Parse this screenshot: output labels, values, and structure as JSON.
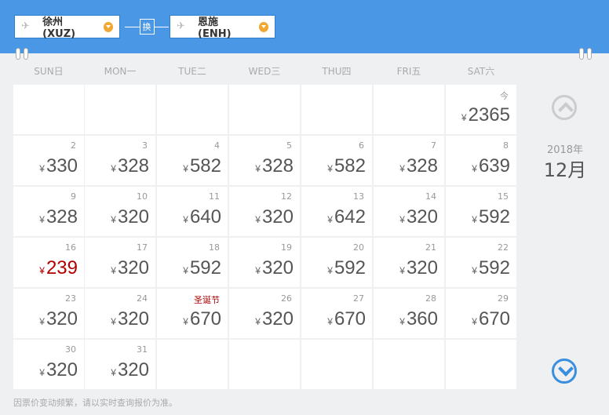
{
  "route": {
    "from": "徐州(XUZ)",
    "to": "恩施(ENH)",
    "swap_label": "换"
  },
  "weekdays": [
    "SUN日",
    "MON一",
    "TUE二",
    "WED三",
    "THU四",
    "FRI五",
    "SAT六"
  ],
  "calendar": {
    "year": "2018年",
    "month": "12月",
    "currency": "¥"
  },
  "weeks": [
    [
      null,
      null,
      null,
      null,
      null,
      null,
      {
        "day": "今",
        "price": "2365"
      }
    ],
    [
      {
        "day": "2",
        "price": "330"
      },
      {
        "day": "3",
        "price": "328"
      },
      {
        "day": "4",
        "price": "582"
      },
      {
        "day": "5",
        "price": "328"
      },
      {
        "day": "6",
        "price": "582"
      },
      {
        "day": "7",
        "price": "328"
      },
      {
        "day": "8",
        "price": "639"
      }
    ],
    [
      {
        "day": "9",
        "price": "328"
      },
      {
        "day": "10",
        "price": "320"
      },
      {
        "day": "11",
        "price": "640"
      },
      {
        "day": "12",
        "price": "320"
      },
      {
        "day": "13",
        "price": "642"
      },
      {
        "day": "14",
        "price": "320"
      },
      {
        "day": "15",
        "price": "592"
      }
    ],
    [
      {
        "day": "16",
        "price": "239",
        "lowest": true
      },
      {
        "day": "17",
        "price": "320"
      },
      {
        "day": "18",
        "price": "592"
      },
      {
        "day": "19",
        "price": "320"
      },
      {
        "day": "20",
        "price": "592"
      },
      {
        "day": "21",
        "price": "320"
      },
      {
        "day": "22",
        "price": "592"
      }
    ],
    [
      {
        "day": "23",
        "price": "320"
      },
      {
        "day": "24",
        "price": "320"
      },
      {
        "day": "圣诞节",
        "price": "670",
        "holiday": true
      },
      {
        "day": "26",
        "price": "320"
      },
      {
        "day": "27",
        "price": "670"
      },
      {
        "day": "28",
        "price": "360"
      },
      {
        "day": "29",
        "price": "670"
      }
    ],
    [
      {
        "day": "30",
        "price": "320"
      },
      {
        "day": "31",
        "price": "320"
      },
      null,
      null,
      null,
      null,
      null
    ]
  ],
  "footer_note": "因票价变动频繁，请以实时查询报价为准。",
  "colors": {
    "header": "#4a97e6",
    "lowest_price": "#b30000",
    "accent": "#f0a832"
  }
}
